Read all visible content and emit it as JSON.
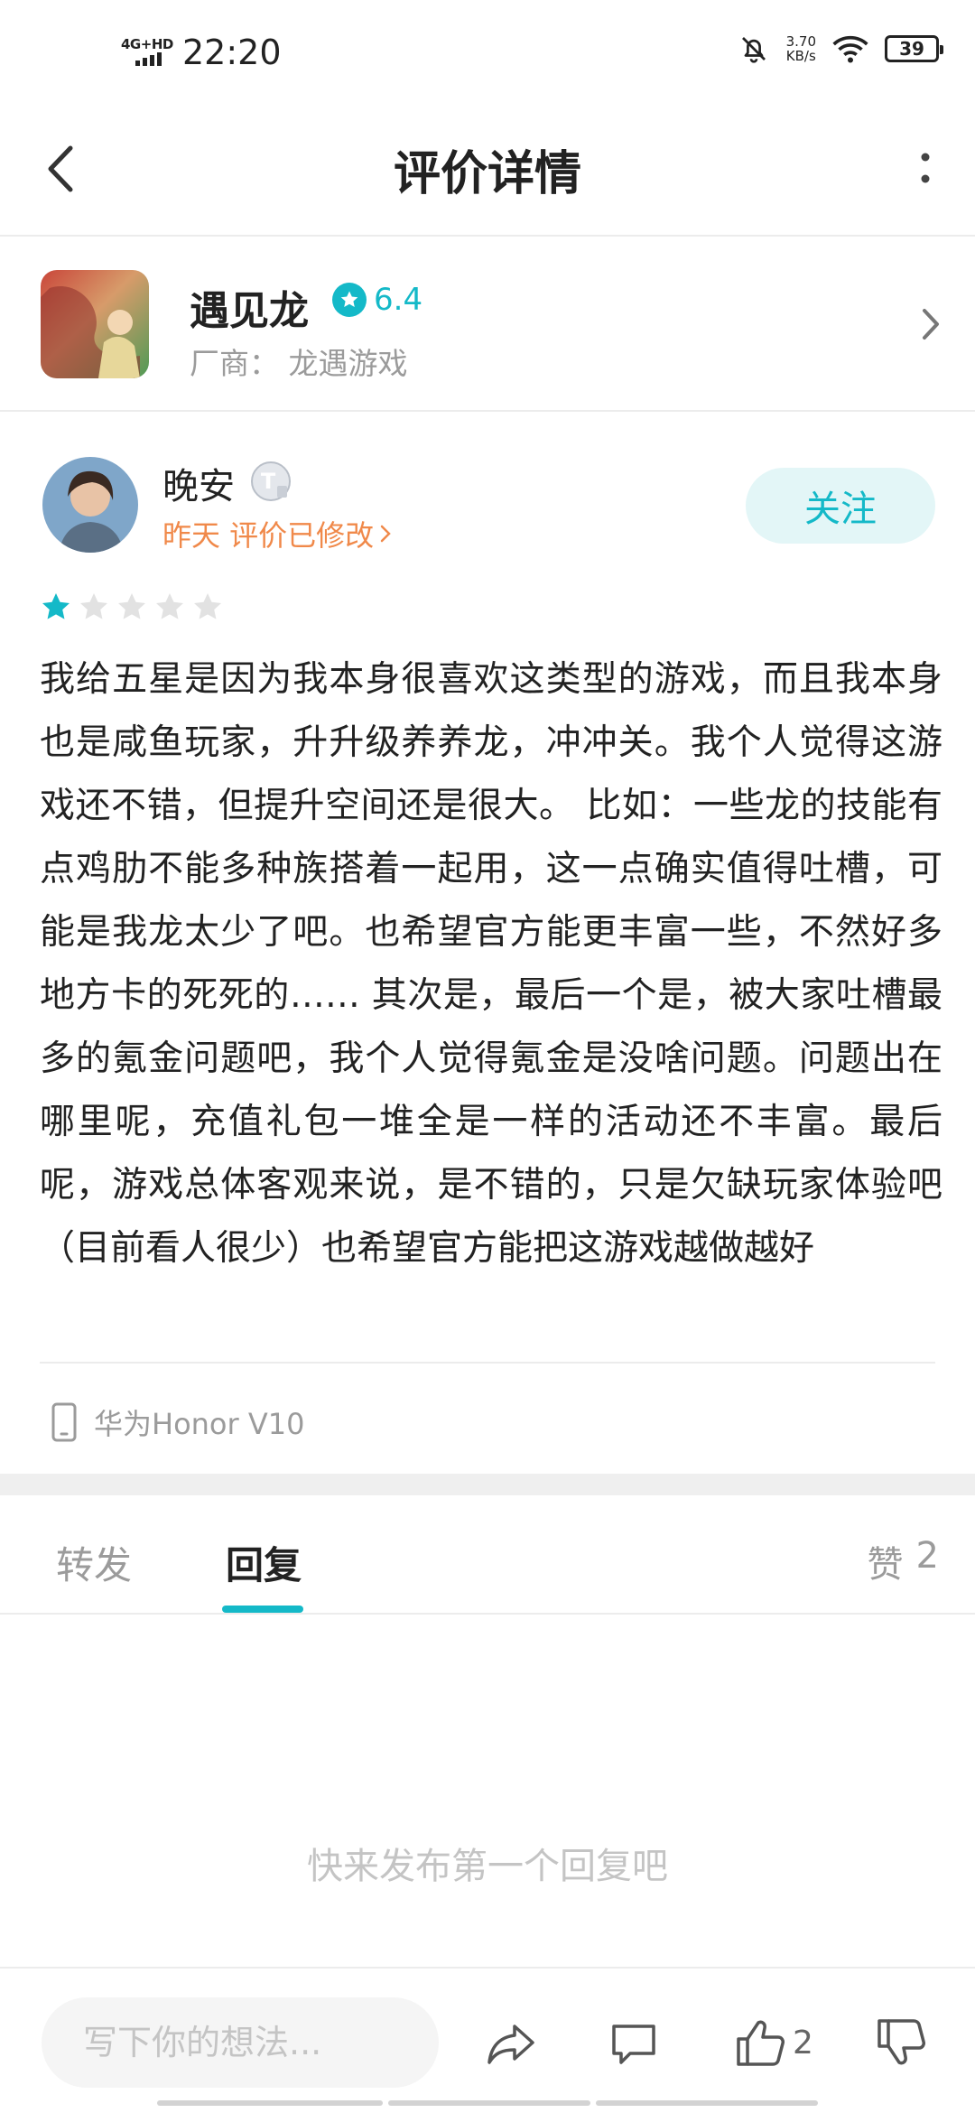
{
  "status_bar": {
    "network": "4G+HD",
    "time": "22:20",
    "net_speed_value": "3.70",
    "net_speed_unit": "KB/s",
    "battery": "39"
  },
  "header": {
    "title": "评价详情"
  },
  "app": {
    "name": "遇见龙",
    "rating": "6.4",
    "vendor": "厂商：  龙遇游戏"
  },
  "review": {
    "user_name": "晚安",
    "level_badge": "T",
    "meta": "昨天  评价已修改",
    "follow_label": "关注",
    "star_rating": 1,
    "star_max": 5,
    "body": "我给五星是因为我本身很喜欢这类型的游戏，而且我本身也是咸鱼玩家，升升级养养龙，冲冲关。我个人觉得这游戏还不错，但提升空间还是很大。 比如：一些龙的技能有点鸡肋不能多种族搭着一起用，这一点确实值得吐槽，可能是我龙太少了吧。也希望官方能更丰富一些，不然好多地方卡的死死的…… 其次是，最后一个是，被大家吐槽最多的氪金问题吧，我个人觉得氪金是没啥问题。问题出在哪里呢，充值礼包一堆全是一样的活动还不丰富。最后呢，游戏总体客观来说，是不错的，只是欠缺玩家体验吧（目前看人很少）也希望官方能把这游戏越做越好",
    "device": "华为Honor V10"
  },
  "tabs": {
    "forward": "转发",
    "reply": "回复",
    "likes_label": "赞",
    "likes_count": "2"
  },
  "empty_hint": "快来发布第一个回复吧",
  "bottom_bar": {
    "input_placeholder": "写下你的想法...",
    "like_count": "2"
  },
  "colors": {
    "accent": "#14b9c8",
    "meta_orange": "#f0894a",
    "muted_text": "#9b9b9b"
  },
  "icons": [
    "back-arrow-icon",
    "more-vertical-icon",
    "chevron-right-icon",
    "star-icon",
    "phone-icon",
    "share-icon",
    "comment-icon",
    "thumbs-up-icon",
    "thumbs-down-icon",
    "wifi-icon",
    "bell-off-icon"
  ]
}
